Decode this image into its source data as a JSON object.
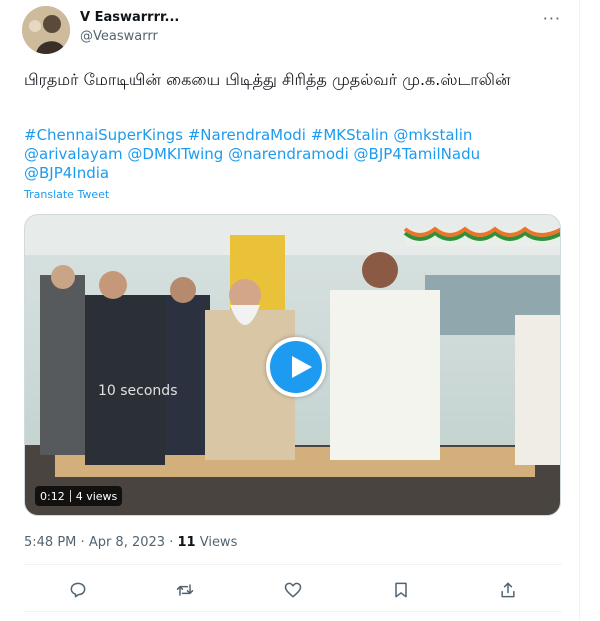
{
  "author": {
    "name": "V Easwarrrr...",
    "handle": "@Veaswarrr"
  },
  "tweet": {
    "text": "பிரதமர் மோடியின் கையை பிடித்து சிரித்த முதல்வர் மு.க.ஸ்டாலின்",
    "tags": [
      "#ChennaiSuperKings",
      "#NarendraModi",
      "#MKStalin",
      "@mkstalin",
      "@arivalayam",
      "@DMKITwing",
      "@narendramodi",
      "@BJP4TamilNadu",
      "@BJP4India"
    ],
    "translate_label": "Translate Tweet"
  },
  "video": {
    "overlay_text": "10 seconds",
    "duration": "0:12",
    "views": "4 views"
  },
  "meta": {
    "time": "5:48 PM",
    "separator": "·",
    "date": "Apr 8, 2023",
    "view_count": "11",
    "views_label": "Views"
  },
  "colors": {
    "accent": "#1d9bf0",
    "text": "#0f1419",
    "secondary": "#536471"
  },
  "icons": [
    "more-icon",
    "reply-icon",
    "retweet-icon",
    "like-icon",
    "bookmark-icon",
    "share-icon"
  ]
}
